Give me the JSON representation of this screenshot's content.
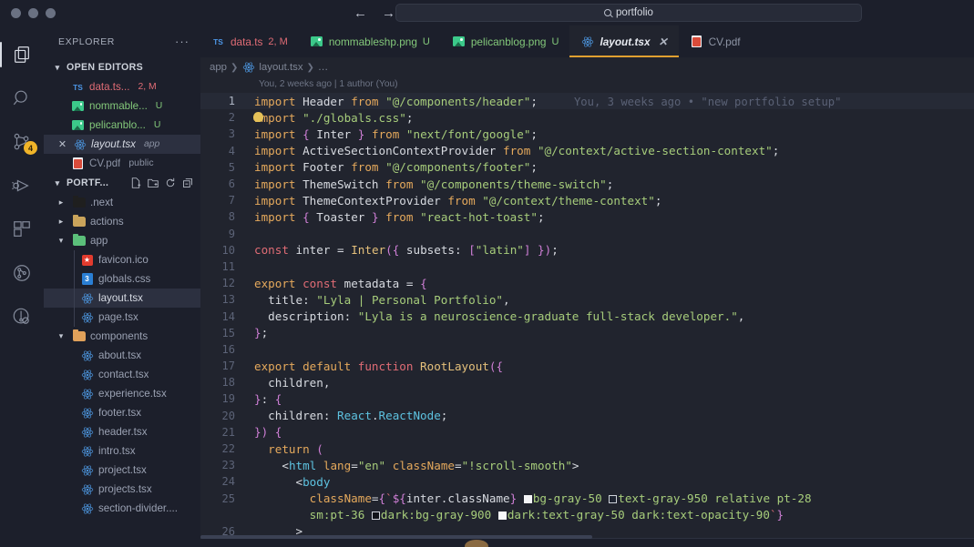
{
  "titlebar": {
    "search_value": "portfolio",
    "back_label": "←",
    "forward_label": "→",
    "search_icon": "search-icon"
  },
  "activitybar": {
    "items": [
      {
        "name": "explorer",
        "icon": "files-icon",
        "active": true,
        "badge": ""
      },
      {
        "name": "search",
        "icon": "search-icon",
        "active": false,
        "badge": ""
      },
      {
        "name": "source-control",
        "icon": "source-control-icon",
        "active": false,
        "badge": "4"
      },
      {
        "name": "run-and-debug",
        "icon": "debug-icon",
        "active": false,
        "badge": ""
      },
      {
        "name": "extensions",
        "icon": "extensions-icon",
        "active": false,
        "badge": ""
      },
      {
        "name": "git-graph",
        "icon": "git-graph-icon",
        "active": false,
        "badge": ""
      },
      {
        "name": "testing",
        "icon": "testing-icon",
        "active": false,
        "badge": ""
      }
    ]
  },
  "sidebar": {
    "title": "EXPLORER",
    "more_actions": "···",
    "open_editors": {
      "label": "OPEN EDITORS",
      "items": [
        {
          "icon": "ts-icon",
          "name": "data.ts...",
          "suffix": "2, M",
          "color": "red",
          "selected": false,
          "close": false
        },
        {
          "icon": "image-icon",
          "name": "nommable...",
          "suffix": "U",
          "color": "green",
          "selected": false,
          "close": false
        },
        {
          "icon": "image-icon",
          "name": "pelicanblo...",
          "suffix": "U",
          "color": "green",
          "selected": false,
          "close": false
        },
        {
          "icon": "react-icon",
          "name": "layout.tsx",
          "suffix": "app",
          "color": "white",
          "selected": true,
          "close": true
        },
        {
          "icon": "pdf-icon",
          "name": "CV.pdf",
          "suffix": "public",
          "color": "grey",
          "selected": false,
          "close": false
        }
      ]
    },
    "project": {
      "label": "PORTF...",
      "actions": [
        "new-file-icon",
        "new-folder-icon",
        "refresh-icon",
        "collapse-all-icon"
      ],
      "tree": [
        {
          "icon": "folder-next-icon",
          "name": ".next",
          "indent": 1,
          "expandable": true,
          "expanded": false,
          "selected": false
        },
        {
          "icon": "folder-icon",
          "name": "actions",
          "indent": 1,
          "expandable": true,
          "expanded": false,
          "selected": false
        },
        {
          "icon": "folder-app-icon",
          "name": "app",
          "indent": 1,
          "expandable": true,
          "expanded": true,
          "selected": false
        },
        {
          "icon": "favicon-icon",
          "name": "favicon.ico",
          "indent": 2,
          "expandable": false,
          "expanded": false,
          "selected": false
        },
        {
          "icon": "css-icon",
          "name": "globals.css",
          "indent": 2,
          "expandable": false,
          "expanded": false,
          "selected": false
        },
        {
          "icon": "react-icon",
          "name": "layout.tsx",
          "indent": 2,
          "expandable": false,
          "expanded": false,
          "selected": true
        },
        {
          "icon": "react-icon",
          "name": "page.tsx",
          "indent": 2,
          "expandable": false,
          "expanded": false,
          "selected": false
        },
        {
          "icon": "folder-components-icon",
          "name": "components",
          "indent": 1,
          "expandable": true,
          "expanded": true,
          "selected": false
        },
        {
          "icon": "react-icon",
          "name": "about.tsx",
          "indent": 2,
          "expandable": false,
          "expanded": false,
          "selected": false
        },
        {
          "icon": "react-icon",
          "name": "contact.tsx",
          "indent": 2,
          "expandable": false,
          "expanded": false,
          "selected": false
        },
        {
          "icon": "react-icon",
          "name": "experience.tsx",
          "indent": 2,
          "expandable": false,
          "expanded": false,
          "selected": false
        },
        {
          "icon": "react-icon",
          "name": "footer.tsx",
          "indent": 2,
          "expandable": false,
          "expanded": false,
          "selected": false
        },
        {
          "icon": "react-icon",
          "name": "header.tsx",
          "indent": 2,
          "expandable": false,
          "expanded": false,
          "selected": false
        },
        {
          "icon": "react-icon",
          "name": "intro.tsx",
          "indent": 2,
          "expandable": false,
          "expanded": false,
          "selected": false
        },
        {
          "icon": "react-icon",
          "name": "project.tsx",
          "indent": 2,
          "expandable": false,
          "expanded": false,
          "selected": false
        },
        {
          "icon": "react-icon",
          "name": "projects.tsx",
          "indent": 2,
          "expandable": false,
          "expanded": false,
          "selected": false
        },
        {
          "icon": "react-icon",
          "name": "section-divider....",
          "indent": 2,
          "expandable": false,
          "expanded": false,
          "selected": false
        }
      ]
    }
  },
  "tabs": [
    {
      "icon": "ts-icon",
      "label": "data.ts",
      "badge": "2, M",
      "active": false,
      "close": false
    },
    {
      "icon": "image-icon",
      "label": "nommableshp.png",
      "badge": "U",
      "active": false,
      "close": false
    },
    {
      "icon": "image-icon",
      "label": "pelicanblog.png",
      "badge": "U",
      "active": false,
      "close": false
    },
    {
      "icon": "react-icon",
      "label": "layout.tsx",
      "badge": "",
      "active": true,
      "close": true
    },
    {
      "icon": "pdf-icon",
      "label": "CV.pdf",
      "badge": "",
      "active": false,
      "close": false
    }
  ],
  "breadcrumb": {
    "parts": [
      "app",
      "layout.tsx",
      "…"
    ],
    "icon": "react-icon"
  },
  "editor": {
    "blame_header": "You, 2 weeks ago | 1 author (You)",
    "inline_blame": "You, 3 weeks ago • \"new portfolio setup\"",
    "accent_color": "#e0a030",
    "lines": [
      {
        "n": "1",
        "text": "import Header from \"@/components/header\";"
      },
      {
        "n": "2",
        "text": "import \"./globals.css\";"
      },
      {
        "n": "3",
        "text": "import { Inter } from \"next/font/google\";"
      },
      {
        "n": "4",
        "text": "import ActiveSectionContextProvider from \"@/context/active-section-context\";"
      },
      {
        "n": "5",
        "text": "import Footer from \"@/components/footer\";"
      },
      {
        "n": "6",
        "text": "import ThemeSwitch from \"@/components/theme-switch\";"
      },
      {
        "n": "7",
        "text": "import ThemeContextProvider from \"@/context/theme-context\";"
      },
      {
        "n": "8",
        "text": "import { Toaster } from \"react-hot-toast\";"
      },
      {
        "n": "9",
        "text": ""
      },
      {
        "n": "10",
        "text": "const inter = Inter({ subsets: [\"latin\"] });"
      },
      {
        "n": "11",
        "text": ""
      },
      {
        "n": "12",
        "text": "export const metadata = {"
      },
      {
        "n": "13",
        "text": "  title: \"Lyla | Personal Portfolio\","
      },
      {
        "n": "14",
        "text": "  description: \"Lyla is a neuroscience-graduate full-stack developer.\","
      },
      {
        "n": "15",
        "text": "};"
      },
      {
        "n": "16",
        "text": ""
      },
      {
        "n": "17",
        "text": "export default function RootLayout({"
      },
      {
        "n": "18",
        "text": "  children,"
      },
      {
        "n": "19",
        "text": "}: {"
      },
      {
        "n": "20",
        "text": "  children: React.ReactNode;"
      },
      {
        "n": "21",
        "text": "}) {"
      },
      {
        "n": "22",
        "text": "  return ("
      },
      {
        "n": "23",
        "text": "    <html lang=\"en\" className=\"!scroll-smooth\">"
      },
      {
        "n": "24",
        "text": "      <body"
      },
      {
        "n": "25",
        "text": "        className={`${inter.className} bg-gray-50 text-gray-950 relative pt-28 sm:pt-36 dark:bg-gray-900 dark:text-gray-50 dark:text-opacity-90`}"
      },
      {
        "n": "26",
        "text": "      >"
      }
    ]
  }
}
